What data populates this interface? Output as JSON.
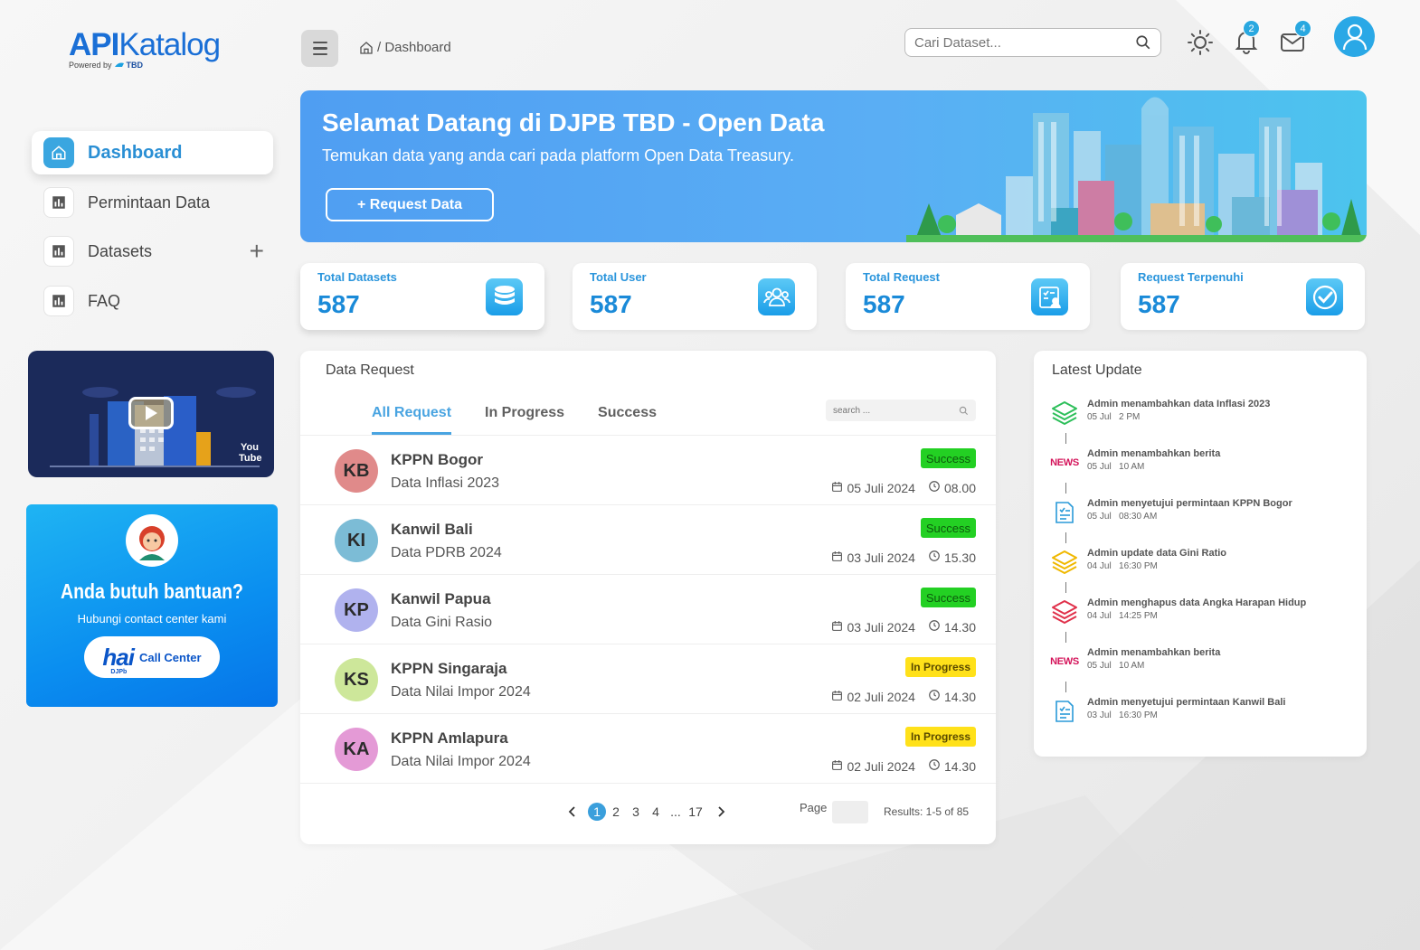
{
  "brand": {
    "name_bold": "API",
    "name_rest": "Katalog",
    "powered": "Powered by",
    "partner": "TBD"
  },
  "sidebar": {
    "items": [
      {
        "label": "Dashboard",
        "active": true
      },
      {
        "label": "Permintaan Data"
      },
      {
        "label": "Datasets",
        "expandable": true
      },
      {
        "label": "FAQ"
      }
    ],
    "help": {
      "title": "Anda butuh bantuan?",
      "subtitle": "Hubungi contact center kami",
      "button_logo": "hai",
      "button_logo_sub": "DJPb",
      "button_label": "Call Center"
    },
    "video": {
      "platform": "You Tube"
    }
  },
  "header": {
    "breadcrumb": "/ Dashboard",
    "search_placeholder": "Cari Dataset...",
    "notifications": "2",
    "messages": "4"
  },
  "hero": {
    "title": "Selamat Datang di DJPB TBD - Open Data",
    "subtitle": "Temukan data yang anda cari pada platform Open Data Treasury.",
    "button": "+ Request Data"
  },
  "stats": [
    {
      "label": "Total Datasets",
      "value": "587",
      "icon": "database-icon"
    },
    {
      "label": "Total User",
      "value": "587",
      "icon": "users-icon"
    },
    {
      "label": "Total Request",
      "value": "587",
      "icon": "request-icon"
    },
    {
      "label": "Request Terpenuhi",
      "value": "587",
      "icon": "check-icon"
    }
  ],
  "data_request": {
    "title": "Data Request",
    "tabs": [
      "All Request",
      "In Progress",
      "Success"
    ],
    "search_placeholder": "search ...",
    "rows": [
      {
        "initials": "KB",
        "name": "KPPN Bogor",
        "dataset": "Data Inflasi 2023",
        "status": "Success",
        "date": "05 Juli 2024",
        "time": "08.00",
        "color": "#e08a8a"
      },
      {
        "initials": "KI",
        "name": "Kanwil Bali",
        "dataset": "Data PDRB 2024",
        "status": "Success",
        "date": "03 Juli 2024",
        "time": "15.30",
        "color": "#7cbcd6"
      },
      {
        "initials": "KP",
        "name": "Kanwil Papua",
        "dataset": "Data Gini Rasio",
        "status": "Success",
        "date": "03 Juli 2024",
        "time": "14.30",
        "color": "#b0b2ee"
      },
      {
        "initials": "KS",
        "name": "KPPN Singaraja",
        "dataset": "Data Nilai Impor 2024",
        "status": "In Progress",
        "date": "02 Juli 2024",
        "time": "14.30",
        "color": "#cde79a"
      },
      {
        "initials": "KA",
        "name": "KPPN Amlapura",
        "dataset": "Data Nilai Impor 2024",
        "status": "In Progress",
        "date": "02 Juli 2024",
        "time": "14.30",
        "color": "#e49ad6"
      }
    ],
    "pagination": {
      "pages": [
        "1",
        "2",
        "3",
        "4",
        "...",
        "17"
      ],
      "current": "1",
      "page_label": "Page",
      "results": "Results: 1-5 of 85"
    }
  },
  "latest_update": {
    "title": "Latest Update",
    "events": [
      {
        "text": "Admin menambahkan data Inflasi 2023",
        "date": "05 Jul",
        "time": "2 PM",
        "icon": "layers-green-icon"
      },
      {
        "text": "Admin menambahkan berita",
        "date": "05 Jul",
        "time": "10 AM",
        "icon": "news-icon"
      },
      {
        "text": "Admin menyetujui permintaan KPPN Bogor",
        "date": "05 Jul",
        "time": "08:30 AM",
        "icon": "document-check-icon"
      },
      {
        "text": "Admin update data Gini Ratio",
        "date": "04 Jul",
        "time": "16:30 PM",
        "icon": "layers-yellow-icon"
      },
      {
        "text": "Admin menghapus data Angka Harapan Hidup",
        "date": "04 Jul",
        "time": "14:25 PM",
        "icon": "layers-red-icon"
      },
      {
        "text": "Admin menambahkan berita",
        "date": "05 Jul",
        "time": "10 AM",
        "icon": "news-icon"
      },
      {
        "text": "Admin menyetujui permintaan Kanwil Bali",
        "date": "03 Jul",
        "time": "16:30 PM",
        "icon": "document-check-icon"
      }
    ],
    "news_label": "NEWS"
  },
  "colors": {
    "accent": "#2a95dc",
    "success": "#23d023",
    "progress": "#ffe11a"
  }
}
